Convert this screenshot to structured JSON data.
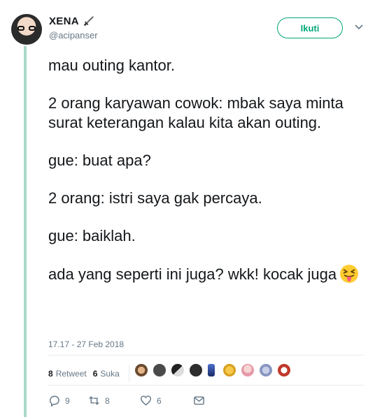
{
  "tweet": {
    "author": {
      "name": "XENA",
      "handle": "@acipanser",
      "badge_icon": "sword-icon"
    },
    "follow_label": "Ikuti",
    "menu_icon": "chevron-down-icon",
    "text_lines": [
      "mau outing kantor.",
      "2 orang karyawan cowok: mbak saya minta surat keterangan kalau kita akan outing.",
      "gue: buat apa?",
      "2 orang: istri saya gak percaya.",
      "gue: baiklah.",
      "ada yang seperti ini juga? wkk! kocak juga"
    ],
    "emoji": "squinting-face-with-tongue",
    "timestamp": "17.17 - 27 Feb 2018",
    "stats": {
      "retweets_count": "8",
      "retweets_label": "Retweet",
      "likes_count": "6",
      "likes_label": "Suka"
    },
    "likers_count": 9,
    "actions": {
      "reply_count": "9",
      "retweet_count": "8",
      "like_count": "6"
    },
    "colors": {
      "accent": "#00a878",
      "thread_line": "#a9d8c9",
      "secondary_text": "#657786"
    }
  }
}
